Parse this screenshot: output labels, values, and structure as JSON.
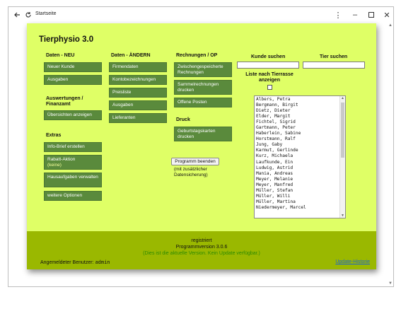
{
  "browser": {
    "tab_title": "Startseite",
    "icons": [
      "back-arrow-icon",
      "reload-icon",
      "kebab-menu-icon",
      "minimize-icon",
      "maximize-icon",
      "close-icon"
    ]
  },
  "app": {
    "title": "Tierphysio 3.0",
    "col1": {
      "heading": "Daten - NEU",
      "buttons": [
        "Neuer Kunde",
        "Ausgaben"
      ],
      "section2_heading": "Auswertungen / Finanzamt",
      "section2_buttons": [
        "Übersichten anzeigen"
      ],
      "section3_heading": "Extras",
      "section3_buttons": [
        "Info-Brief erstellen",
        "Rabatt-Aktion",
        "Hausaufgaben verwalten",
        "weitere Optionen"
      ],
      "rabatt_status": "(keine)"
    },
    "col2": {
      "heading": "Daten - ÄNDERN",
      "buttons": [
        "Firmendaten",
        "Kontobezeichnungen",
        "Preisliste",
        "Ausgaben",
        "Lieferanten"
      ]
    },
    "col3": {
      "heading": "Rechnungen / OP",
      "buttons": [
        "Zwischengespeicherte Rechnungen",
        "Sammelrechnungen drucken",
        "Offene Posten"
      ],
      "section2_heading": "Druck",
      "section2_buttons": [
        "Geburtstagskarten drucken"
      ],
      "program_end_label": "Programm beenden",
      "program_end_note": "(mit zusätzlicher Datensicherung)"
    },
    "search": {
      "customer_label": "Kunde suchen",
      "animal_label": "Tier suchen",
      "customer_value": "",
      "animal_value": "",
      "race_list_label": "Liste nach Tierrasse anzeigen",
      "race_list_checked": false
    },
    "customer_list": [
      "Albers, Petra",
      "Bergmann, Birgit",
      "Dietz, Dieter",
      "Elder, Margit",
      "Fichtel, Sigrid",
      "Gartmann, Peter",
      "Haberlein, Sabine",
      "Horstmann, Ralf",
      "Jung, Gaby",
      "Karmut, Gerlinde",
      "Kurz, Michaela",
      "Laufkunde, Ein",
      "Ludwig, Astrid",
      "Mania, Andreas",
      "Meyer, Melanie",
      "Meyer, Manfred",
      "Müller, Stefan",
      "Müller, Willi",
      "Müller, Martina",
      "Niedermeyer, Marcel"
    ],
    "footer": {
      "status": "registriert",
      "version": "Programmversion 3.0.6",
      "update_note": "(Dies ist die aktuelle Version. Kein Update verfügbar.)",
      "user_label": "Angemeldeter Benutzer:",
      "user_name": "admin",
      "history_link": "Update-Historie"
    },
    "colors": {
      "background": "#dfff66",
      "button": "#5a8a3c",
      "footer": "#9ab800",
      "link": "#1a5fd6"
    }
  }
}
